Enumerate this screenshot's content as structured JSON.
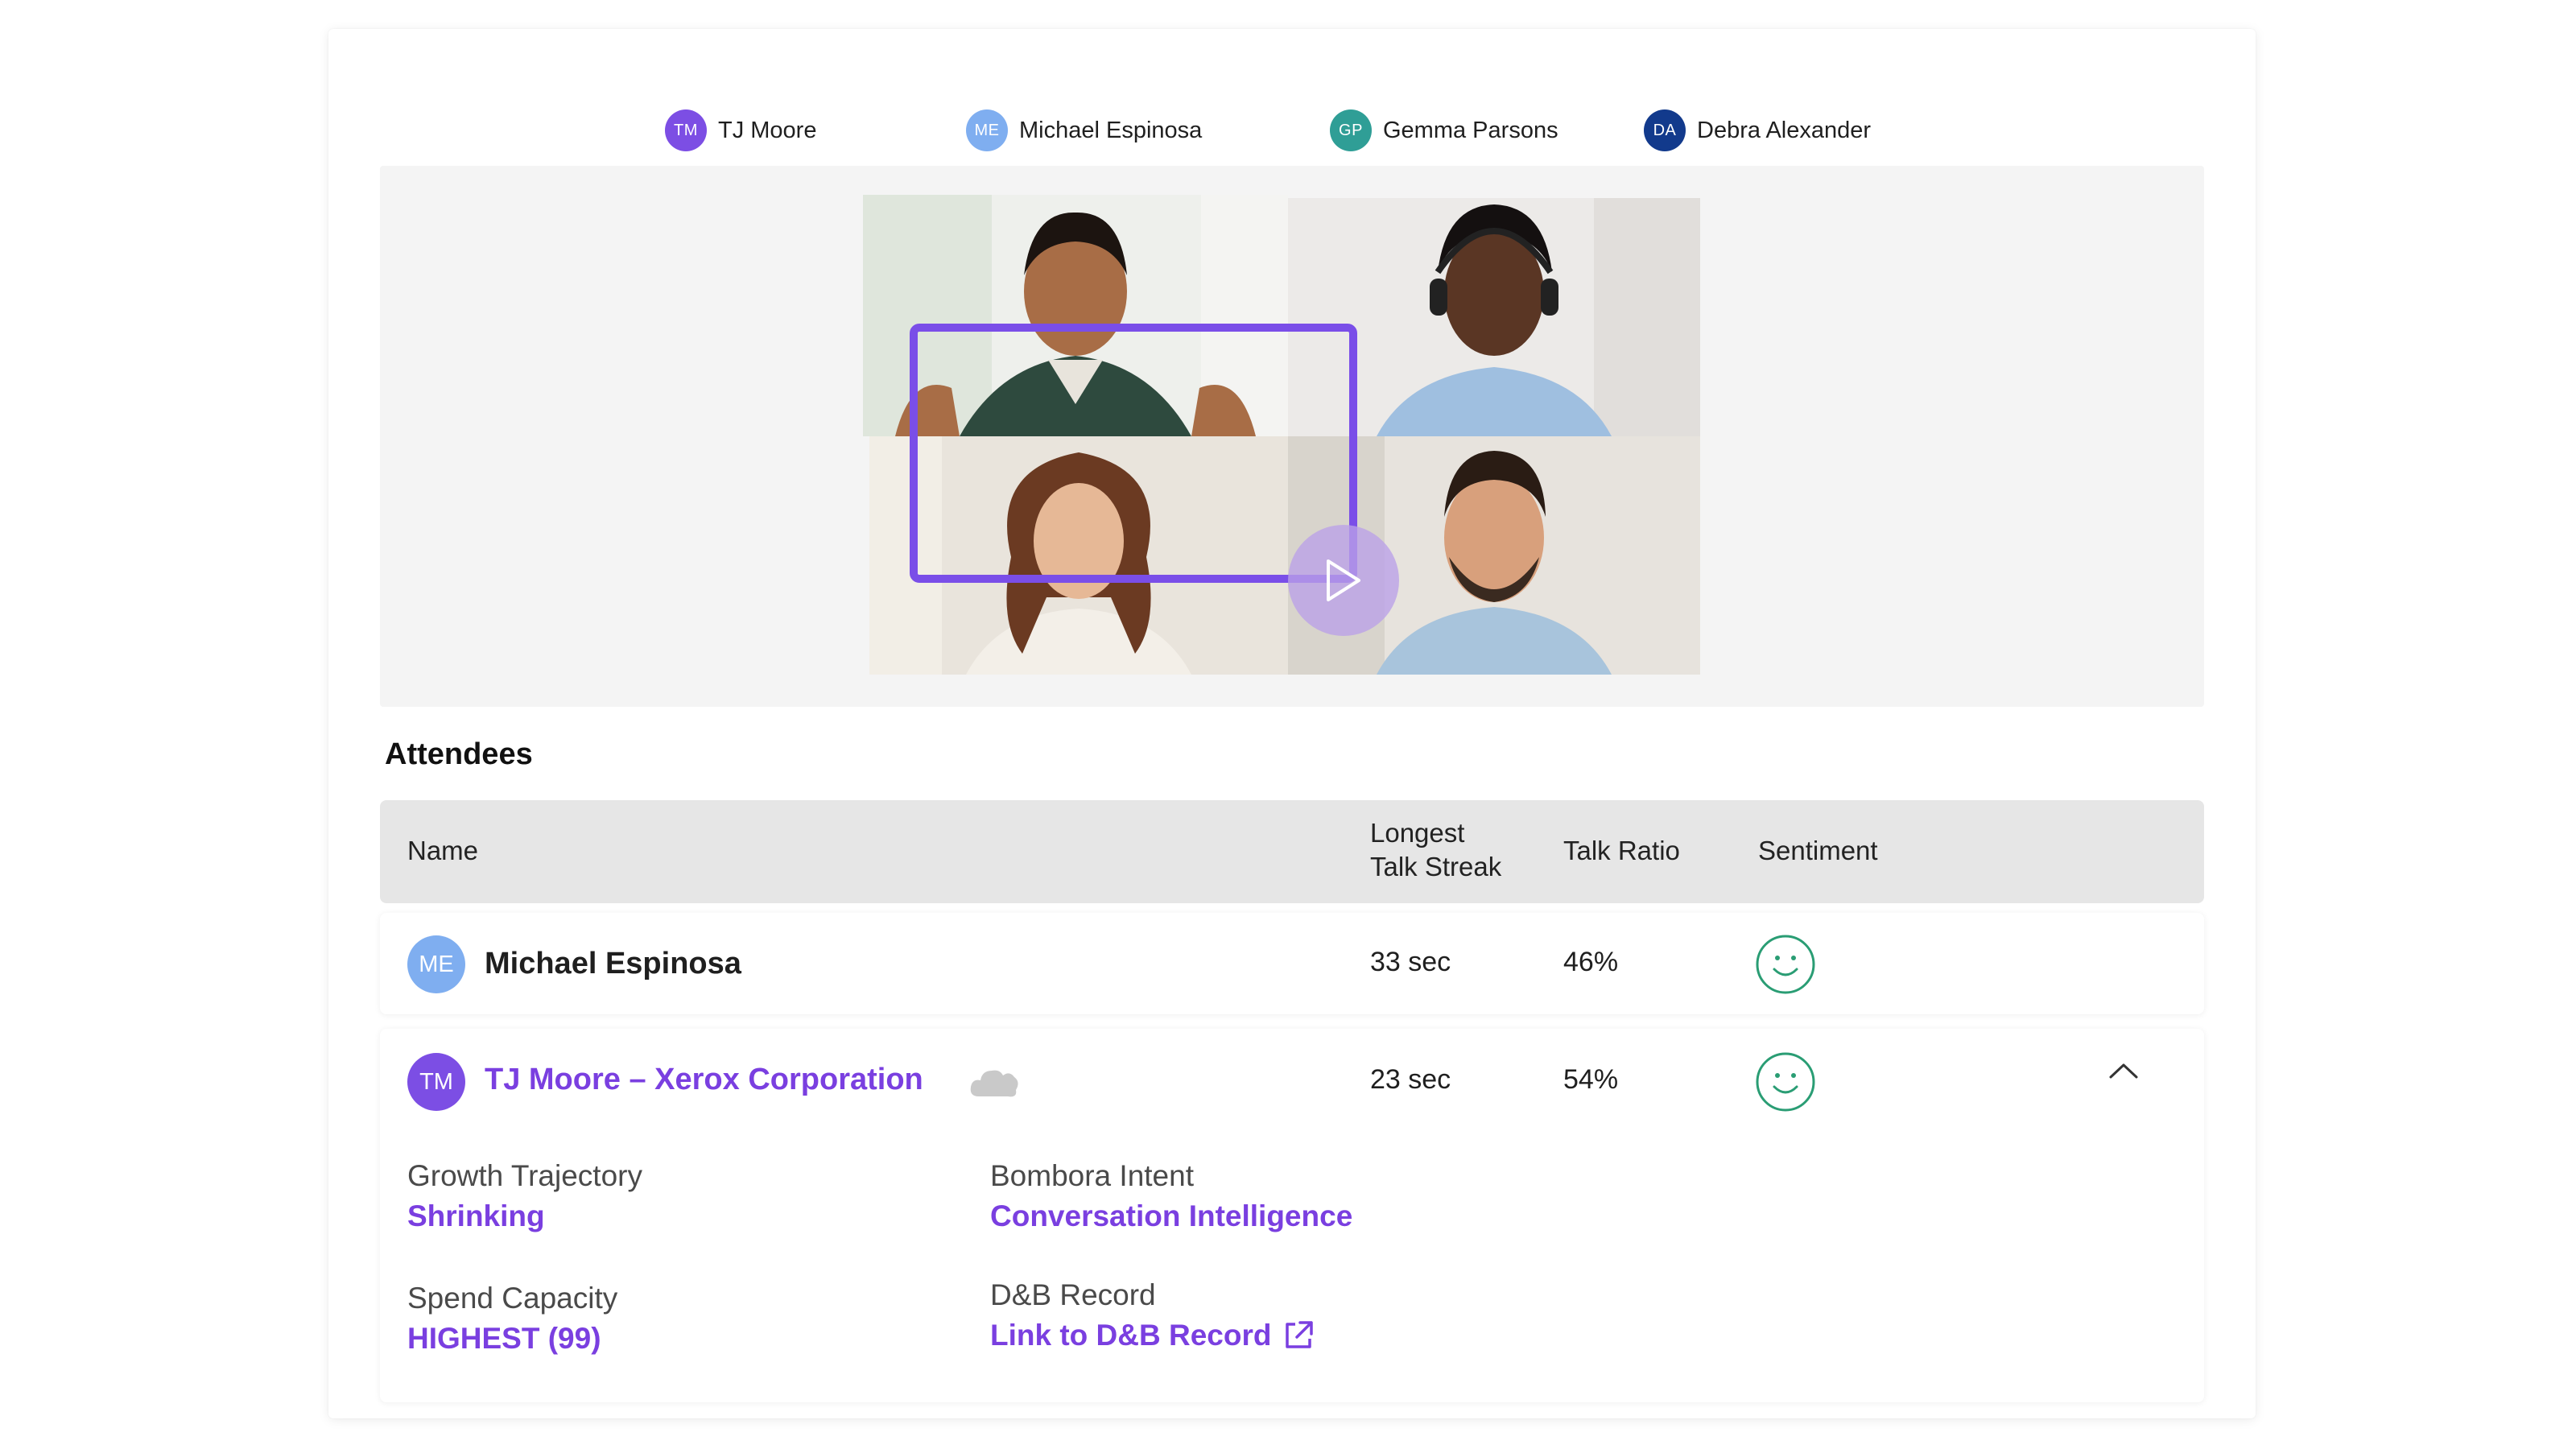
{
  "participants": [
    {
      "initials": "TM",
      "name": "TJ Moore",
      "color": "#7c4ee4"
    },
    {
      "initials": "ME",
      "name": "Michael Espinosa",
      "color": "#7faef0"
    },
    {
      "initials": "GP",
      "name": "Gemma Parsons",
      "color": "#2f9e96"
    },
    {
      "initials": "DA",
      "name": "Debra Alexander",
      "color": "#123a8c"
    }
  ],
  "video": {
    "play_icon": "play-icon",
    "active_speaker_color": "#7a4ee8"
  },
  "attendees": {
    "title": "Attendees",
    "columns": {
      "name": "Name",
      "streak_line1": "Longest",
      "streak_line2": "Talk Streak",
      "ratio": "Talk Ratio",
      "sentiment": "Sentiment"
    },
    "rows": [
      {
        "initials": "ME",
        "avatar_color": "#7faef0",
        "name": "Michael Espinosa",
        "streak": "33 sec",
        "ratio": "46%",
        "sentiment_icon": "smiley-icon"
      },
      {
        "initials": "TM",
        "avatar_color": "#7c4ee4",
        "name": "TJ Moore – Xerox Corporation",
        "streak": "23 sec",
        "ratio": "54%",
        "sentiment_icon": "smiley-icon",
        "details": {
          "growth_label": "Growth Trajectory",
          "growth_value": "Shrinking",
          "bombora_label": "Bombora Intent",
          "bombora_value": "Conversation Intelligence",
          "spend_label": "Spend Capacity",
          "spend_value": "HIGHEST (99)",
          "dnb_label": "D&B Record",
          "dnb_link": "Link to D&B Record"
        }
      }
    ]
  },
  "colors": {
    "accent": "#7a3fe0",
    "sentiment": "#2a9d74",
    "header_bg": "#e6e6e6"
  }
}
